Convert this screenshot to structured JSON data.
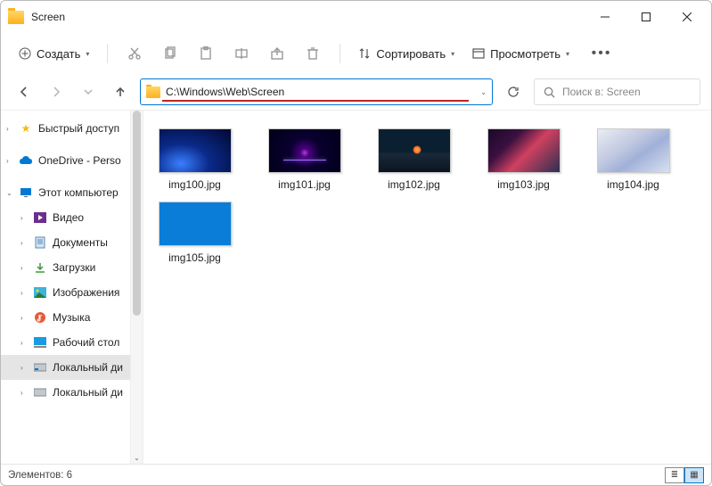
{
  "window": {
    "title": "Screen"
  },
  "toolbar": {
    "create": "Создать",
    "sort": "Сортировать",
    "view": "Просмотреть"
  },
  "address": {
    "path": "C:\\Windows\\Web\\Screen"
  },
  "search": {
    "placeholder": "Поиск в: Screen"
  },
  "sidebar": {
    "quick": "Быстрый доступ",
    "onedrive": "OneDrive - Perso",
    "pc": "Этот компьютер",
    "video": "Видео",
    "docs": "Документы",
    "downloads": "Загрузки",
    "pictures": "Изображения",
    "music": "Музыка",
    "desktop": "Рабочий стол",
    "disk1": "Локальный ди",
    "disk2": "Локальный ди"
  },
  "files": [
    {
      "name": "img100.jpg",
      "css": "i100"
    },
    {
      "name": "img101.jpg",
      "css": "i101"
    },
    {
      "name": "img102.jpg",
      "css": "i102"
    },
    {
      "name": "img103.jpg",
      "css": "i103"
    },
    {
      "name": "img104.jpg",
      "css": "i104"
    },
    {
      "name": "img105.jpg",
      "css": "i105"
    }
  ],
  "status": {
    "count_label": "Элементов: 6"
  }
}
